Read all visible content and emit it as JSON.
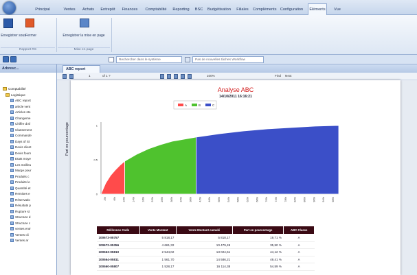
{
  "ribbon": {
    "tabs": [
      "Principal",
      "Ventes",
      "Achats",
      "Entrepôt",
      "Finances",
      "Comptabilité",
      "Reporting",
      "BSC",
      "Budgétisation",
      "Filiales",
      "Compléments",
      "Configuration",
      "Éléments",
      "Vue"
    ],
    "active_tab": "Éléments",
    "buttons": {
      "save_close": "Enregistrer sous",
      "close": "Fermer",
      "save_layout": "Enregistrer la mise en page"
    },
    "groups": {
      "report": "Rapport RS",
      "layout": "Mise en page"
    }
  },
  "quickbar": {
    "search_placeholder": "Rechercher dans le système",
    "tasks": "Pas de nouvelles tâches Workflow"
  },
  "left_panel": {
    "title": "Arbresc...",
    "tree": [
      "Comptabilité",
      "Logistique",
      "ABC report",
      "article vent",
      "Articles sto",
      "Changeme",
      "Chiffre d'af",
      "Classement",
      "Commande",
      "Days of St",
      "Devis client",
      "Devis fourn",
      "Etats moye",
      "Les meilleu",
      "Marge pour",
      "Produits c",
      "Produits le",
      "Quantité et",
      "Remises e",
      "Réservatio",
      "Résultats p",
      "Rupture st",
      "Structure d",
      "Structure c",
      "ventes entr",
      "Ventes cli",
      "Ventes ar"
    ]
  },
  "document": {
    "tab_label": "ABC report",
    "toolbar": {
      "page": "1",
      "of_pages": "of 1 ?",
      "zoom": "100%",
      "find": "Find",
      "next": "Next"
    }
  },
  "report": {
    "title": "Analyse ABC",
    "date": "14/10/2011 16:16:21",
    "ylabel": "Part en pourcentage",
    "table": {
      "headers": [
        "Référence Code",
        "Vente Montant",
        "Vente Montant cumulé",
        "Part en pourcentage",
        "ABC Classe"
      ],
      "rows": [
        [
          "100673-05757",
          "5 818,17",
          "5 818,17",
          "19,71 %",
          "A"
        ],
        [
          "100672-05356",
          "4 661,32",
          "10 479,49",
          "35,50 %",
          "A"
        ],
        [
          "100563-05810",
          "2 544,02",
          "13 024,51",
          "44,12 %",
          "A"
        ],
        [
          "100564-05811",
          "1 561,70",
          "14 586,21",
          "49,41 %",
          "A"
        ],
        [
          "100560-05807",
          "1 528,17",
          "16 114,38",
          "54,59 %",
          "A"
        ]
      ]
    }
  },
  "chart_data": {
    "type": "area",
    "title": "",
    "xlabel": "",
    "ylabel": "Part en pourcentage",
    "legend": [
      "A",
      "B",
      "C"
    ],
    "legend_position": "top",
    "colors": {
      "A": "#ff4b4b",
      "B": "#4fc22e",
      "C": "#3b4fc8"
    },
    "ylim": [
      0,
      1
    ],
    "y_ticks": [
      "1",
      "0.5",
      "0"
    ],
    "x_tick_labels": [
      "2%",
      "6%",
      "10%",
      "14%",
      "18%",
      "22%",
      "26%",
      "30%",
      "34%",
      "38%",
      "42%",
      "46%",
      "50%",
      "54%",
      "58%",
      "62%",
      "66%",
      "70%",
      "74%",
      "78%",
      "82%",
      "86%",
      "90%",
      "94%",
      "98%"
    ],
    "series": [
      {
        "name": "A",
        "x": [
          0,
          0.02,
          0.04,
          0.06,
          0.08,
          0.1
        ],
        "y": [
          0,
          0.16,
          0.27,
          0.35,
          0.42,
          0.48
        ]
      },
      {
        "name": "B",
        "x": [
          0.1,
          0.15,
          0.2,
          0.25,
          0.3,
          0.35,
          0.4
        ],
        "y": [
          0.48,
          0.58,
          0.66,
          0.72,
          0.77,
          0.8,
          0.83
        ]
      },
      {
        "name": "C",
        "x": [
          0.4,
          0.5,
          0.6,
          0.7,
          0.8,
          0.9,
          1.0
        ],
        "y": [
          0.83,
          0.88,
          0.92,
          0.95,
          0.97,
          0.99,
          1.0
        ]
      }
    ]
  }
}
